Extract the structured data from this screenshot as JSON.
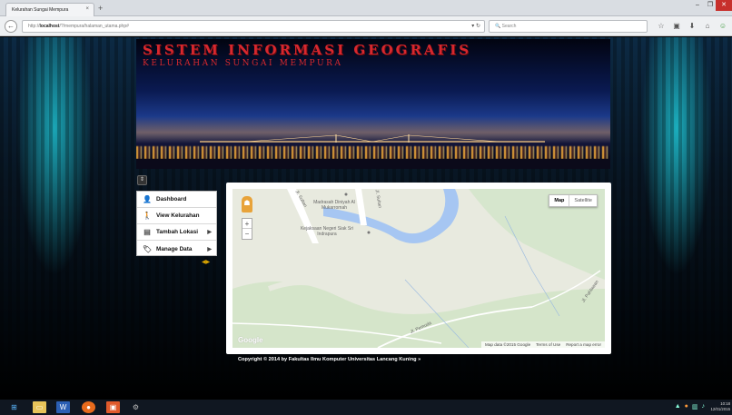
{
  "browser": {
    "tab_title": "Kelurahan Sungai Mempura",
    "tab_close": "×",
    "new_tab": "+",
    "url_prefix": "http://",
    "url_host": "localhost",
    "url_path": "/?/mempura/halaman_utama.php#",
    "search_placeholder": "Search",
    "window_controls": {
      "minimize": "–",
      "maximize": "❐",
      "close": "✕"
    }
  },
  "banner": {
    "title": "SISTEM INFORMASI GEOGRAFIS",
    "subtitle": "KELURAHAN SUNGAI MEMPURA"
  },
  "menu": {
    "items": [
      {
        "label": "Dashboard",
        "icon": "user-icon",
        "glyph": "👤",
        "has_submenu": false
      },
      {
        "label": "View Kelurahan",
        "icon": "walking-icon",
        "glyph": "🚶",
        "has_submenu": false
      },
      {
        "label": "Tambah Lokasi",
        "icon": "database-icon",
        "glyph": "▤",
        "has_submenu": true
      },
      {
        "label": "Manage Data",
        "icon": "tag-icon",
        "glyph": "🏷",
        "has_submenu": true
      }
    ],
    "arrow_glyph": "▶",
    "toggle_glyph": "◀▶",
    "collapse_glyph": "⇕"
  },
  "map": {
    "type_buttons": [
      "Map",
      "Satellite"
    ],
    "active_type": "Map",
    "zoom_in": "+",
    "zoom_out": "−",
    "poi": [
      {
        "name": "Madrasah Diniyah Al Mukarromah"
      },
      {
        "name": "Kejaksaan Negeri Siak Sri Indrapura"
      }
    ],
    "road_labels": [
      "Jl. Sultan",
      "Jl. Sultan",
      "Jl. Pemuda",
      "Jl. Pahlawan"
    ],
    "logo": "Google",
    "footer": [
      "Map data ©2015 Google",
      "Terms of Use",
      "Report a map error"
    ],
    "colors": {
      "river": "#a6c6f2",
      "land": "#e8eadf",
      "green": "#cfe4c4",
      "road": "#ffffff"
    }
  },
  "footer": {
    "copyright": "Copyright © 2014 by Fakultas Ilmu Komputer Universitas Lancang Kuning »"
  },
  "taskbar": {
    "clock_time": "10:18",
    "clock_date": "12/01/2015"
  }
}
